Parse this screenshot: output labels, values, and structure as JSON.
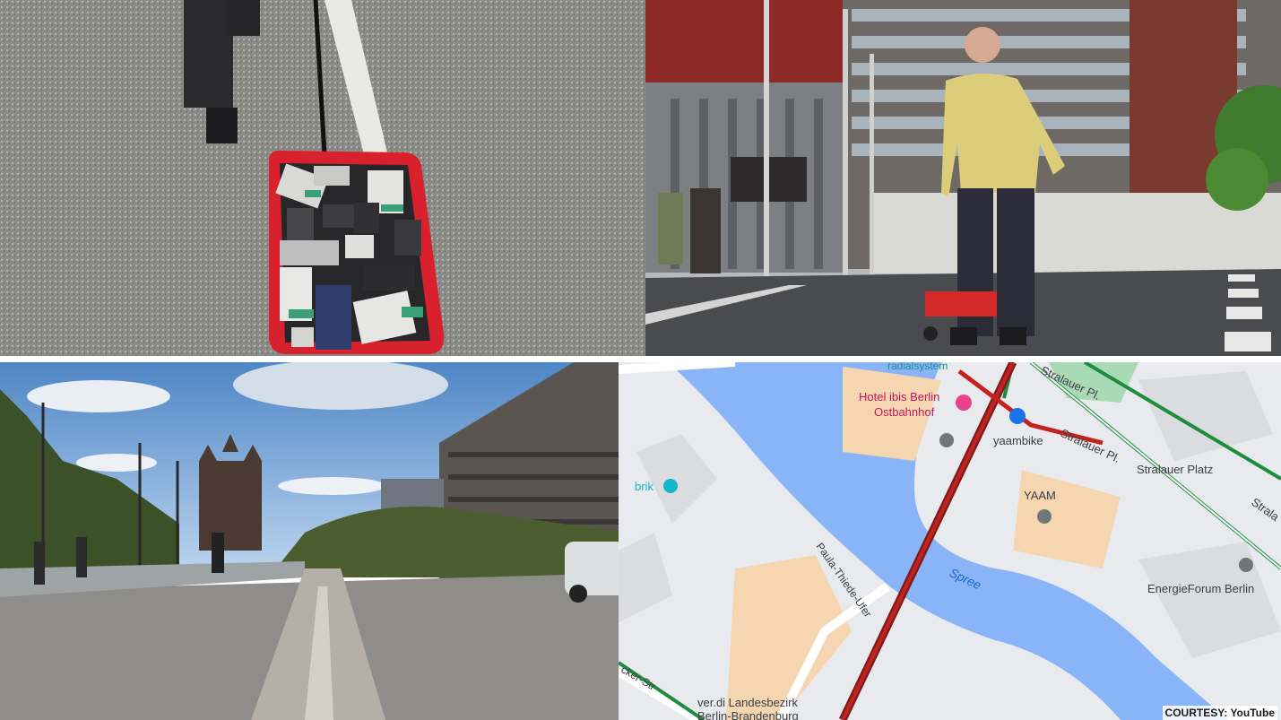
{
  "panels": {
    "wagon": {
      "subject": "phones-in-wagon"
    },
    "man": {
      "subject": "man-pulling-wagon"
    },
    "bridge": {
      "subject": "empty-bridge"
    },
    "map": {
      "labels": {
        "hotel": "Hotel ibis Berlin",
        "hotel2": "Ostbahnhof",
        "radial": "radialsystem",
        "yaambike": "yaambike",
        "yaam": "YAAM",
        "stralauer_pl1": "Stralauer Pl.",
        "stralauer_pl2": "Stralauer Pl.",
        "stralauer_platz": "Stralauer Platz",
        "strala": "Strala",
        "spree": "Spree",
        "paula": "Paula-Thiede-Ufer",
        "energie": "EnergieForum Berlin",
        "brik": "brik",
        "verdi1": "ver.di Landesbezirk",
        "verdi2": "Berlin-Brandenburg",
        "cker": "cker-Str"
      },
      "colors": {
        "water": "#8ab4f8",
        "land": "#e8eaed",
        "block": "#f5d6b0",
        "traffic_red": "#c5221f",
        "traffic_dark": "#7f1d1d",
        "traffic_green": "#1e8e3e",
        "park": "#a8dab5",
        "poi_pink": "#e8438a"
      }
    }
  },
  "credit": "COURTESY: YouTube"
}
